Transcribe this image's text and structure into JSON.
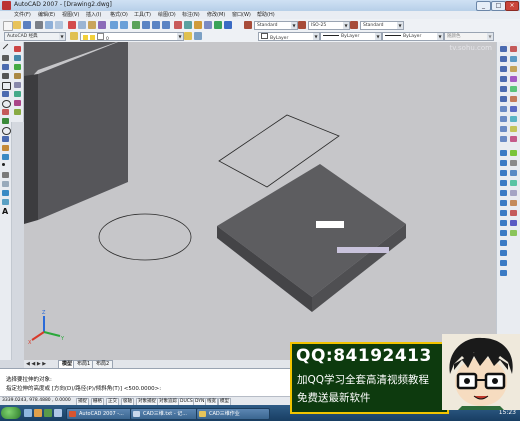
{
  "window": {
    "title": "AutoCAD 2007 - [Drawing2.dwg]",
    "controls": {
      "minimize": "_",
      "maximize": "□",
      "close": "×"
    }
  },
  "menu": {
    "items": [
      "文件(F)",
      "编辑(E)",
      "视图(V)",
      "插入(I)",
      "格式(O)",
      "工具(T)",
      "绘图(D)",
      "标注(N)",
      "修改(M)",
      "窗口(W)",
      "帮助(H)"
    ]
  },
  "toolbar": {
    "workspace": "AutoCAD 经典",
    "text_style": "Standard",
    "dim_style": "ISO-25",
    "table_style": "Standard",
    "layer_color": "ByLayer",
    "linetype": "ByLayer",
    "lineweight": "ByLayer",
    "plot_style": "随颜色"
  },
  "canvas": {
    "watermark": "tv.sohu.com"
  },
  "layout_tabs": [
    "模型",
    "布局1",
    "布局2"
  ],
  "command": {
    "line1": "选择要拉伸的对象:",
    "line2": "指定拉伸的高度或 [方向(D)/路径(P)/倾斜角(T)] <500.0000>:"
  },
  "status": {
    "coords": "3339.0243, 978.4880 , 0.0000",
    "buttons": [
      "捕捉",
      "栅格",
      "正交",
      "极轴",
      "对象捕捉",
      "对象追踪",
      "DUCS",
      "DYN",
      "线宽",
      "模型"
    ]
  },
  "taskbar": {
    "items": [
      "AutoCAD 2007 -...",
      "CAD三维.txt - 记...",
      "CAD三维作业"
    ],
    "clock": "15:23"
  },
  "promo": {
    "qq": "QQ:84192413",
    "line1": "加QQ学习全套高清视频教程",
    "line2": "免费送最新软件"
  },
  "colors": {
    "canvas": "#c6c6c9",
    "solid_top": "#5c5c5f",
    "solid_front": "#444447",
    "solid_right": "#525255",
    "promo_bg": "#0d3a0e",
    "promo_border": "#f2c400"
  }
}
